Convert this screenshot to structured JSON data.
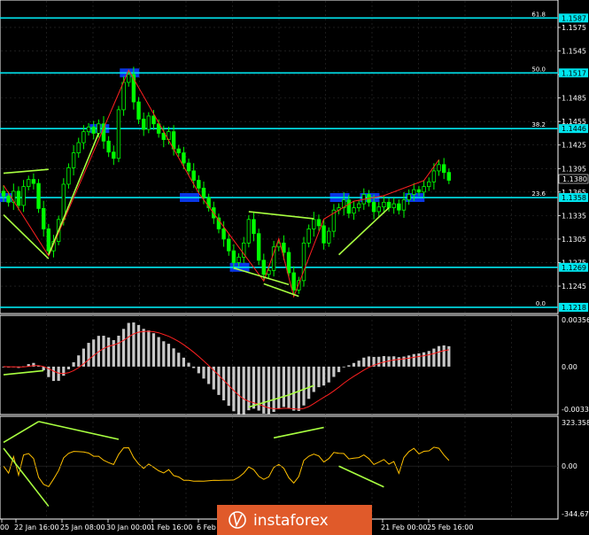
{
  "colors": {
    "background": "#000000",
    "frame": "#ffffff",
    "grid": "#2e2e2e",
    "bull_candle": "#00ff00",
    "bear_candle": "#00ff00",
    "fib_line": "#00e5ee",
    "fib_tag_bg": "#00e5ee",
    "zigzag": "#ff2020",
    "trendline": "#a8ff40",
    "zone": "#0a3cff",
    "macd_hist": "#c8c8c8",
    "macd_signal": "#ff2020",
    "cci_line": "#ffc000",
    "watermark_bg": "#e05a2a"
  },
  "watermark": {
    "text": "instaforex",
    "icon": "instaforex-logo-icon"
  },
  "chart_data": [
    {
      "type": "candlestick",
      "panel": "price",
      "ylim": [
        1.121,
        1.161
      ],
      "y_ticks": [
        "1.1575",
        "1.1545",
        "1.1515",
        "1.1485",
        "1.1455",
        "1.1425",
        "1.1395",
        "1.1365",
        "1.1335",
        "1.1305",
        "1.1275",
        "1.1245"
      ],
      "current_price": "1.1380",
      "fib_levels": [
        {
          "label": "61.8",
          "value": 1.1587,
          "tag": "1.1587"
        },
        {
          "label": "50.0",
          "value": 1.1517,
          "tag": "1.1517"
        },
        {
          "label": "38.2",
          "value": 1.1446,
          "tag": "1.1446"
        },
        {
          "label": "23.6",
          "value": 1.1358,
          "tag": "1.1358"
        },
        {
          "label": "",
          "value": 1.1269,
          "tag": "1.1269"
        },
        {
          "label": "0.0",
          "value": 1.1218,
          "tag": "1.1218"
        }
      ],
      "closes": [
        1.136,
        1.1352,
        1.1366,
        1.1348,
        1.1372,
        1.1381,
        1.1376,
        1.1344,
        1.1318,
        1.129,
        1.1302,
        1.133,
        1.1375,
        1.1396,
        1.1415,
        1.1428,
        1.1442,
        1.1448,
        1.144,
        1.1452,
        1.143,
        1.1416,
        1.1408,
        1.147,
        1.1505,
        1.1515,
        1.148,
        1.1458,
        1.1445,
        1.1462,
        1.1452,
        1.144,
        1.1432,
        1.1442,
        1.142,
        1.1415,
        1.1402,
        1.1392,
        1.138,
        1.137,
        1.1358,
        1.1345,
        1.1332,
        1.1318,
        1.1305,
        1.129,
        1.1275,
        1.1282,
        1.13,
        1.133,
        1.1312,
        1.1278,
        1.126,
        1.1265,
        1.1295,
        1.13,
        1.1288,
        1.1262,
        1.124,
        1.1252,
        1.13,
        1.1318,
        1.133,
        1.1322,
        1.13,
        1.1315,
        1.1342,
        1.1345,
        1.1355,
        1.1338,
        1.1345,
        1.135,
        1.1362,
        1.1352,
        1.134,
        1.1346,
        1.1352,
        1.1345,
        1.135,
        1.1342,
        1.1355,
        1.1362,
        1.1368,
        1.1365,
        1.1372,
        1.1378,
        1.1392,
        1.14,
        1.139,
        1.138
      ],
      "zigzag_x": [
        0,
        9,
        25,
        39,
        52,
        55,
        58,
        64,
        70,
        76,
        84,
        87
      ],
      "trendlines": [
        [
          [
            0,
            1.1389
          ],
          [
            9,
            1.1394
          ]
        ],
        [
          [
            0,
            1.1336
          ],
          [
            9,
            1.128
          ]
        ],
        [
          [
            9,
            1.1285
          ],
          [
            19,
            1.144
          ]
        ],
        [
          [
            46,
            1.1268
          ],
          [
            57,
            1.1247
          ]
        ],
        [
          [
            49,
            1.134
          ],
          [
            62,
            1.1331
          ]
        ],
        [
          [
            52,
            1.1248
          ],
          [
            59,
            1.1232
          ]
        ],
        [
          [
            67,
            1.1285
          ],
          [
            77,
            1.1345
          ]
        ]
      ],
      "zones": [
        [
          0,
          1.1358
        ],
        [
          19,
          1.1446
        ],
        [
          25,
          1.1517
        ],
        [
          37,
          1.1358
        ],
        [
          47,
          1.1269
        ],
        [
          67,
          1.1358
        ],
        [
          73,
          1.1358
        ],
        [
          82,
          1.1358
        ]
      ]
    },
    {
      "type": "bar",
      "panel": "macd",
      "ylim": [
        -0.00355,
        0.0038
      ],
      "y_ticks": [
        "0.00356",
        "0.00",
        "-0.00334"
      ],
      "trendlines": [
        [
          [
            0,
            -0.0006
          ],
          [
            8,
            -0.0003
          ]
        ],
        [
          [
            49,
            -0.003
          ],
          [
            57,
            -0.0021
          ]
        ],
        [
          [
            57,
            -0.0021
          ],
          [
            62,
            -0.0014
          ]
        ]
      ]
    },
    {
      "type": "line",
      "panel": "cci",
      "ylim": [
        -356,
        335
      ],
      "y_ticks": [
        "323.3582",
        "0.00",
        "-344.6727"
      ],
      "trendlines": [
        [
          [
            0,
            160
          ],
          [
            7,
            300
          ]
        ],
        [
          [
            7,
            300
          ],
          [
            23,
            180
          ]
        ],
        [
          [
            0,
            120
          ],
          [
            9,
            -270
          ]
        ],
        [
          [
            54,
            190
          ],
          [
            64,
            260
          ]
        ],
        [
          [
            67,
            0
          ],
          [
            76,
            -140
          ]
        ]
      ]
    }
  ],
  "x_axis": {
    "labels": [
      "00",
      "22 Jan 16:00",
      "25 Jan 08:00",
      "30 Jan 00:00",
      "1 Feb 16:00",
      "6 Feb",
      "21 Feb 00:00",
      "25 Feb 16:00"
    ]
  }
}
